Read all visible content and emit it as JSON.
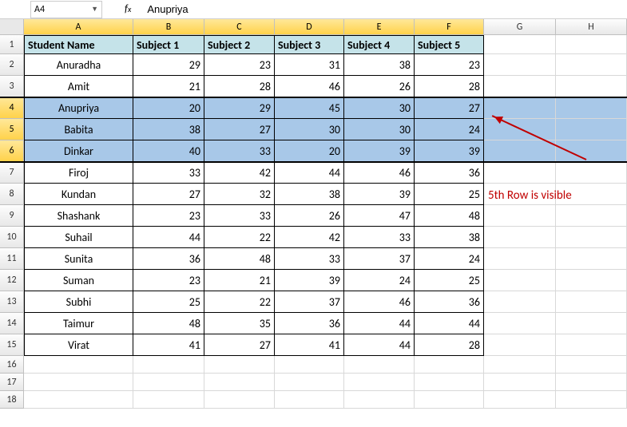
{
  "name_box": "A4",
  "formula_value": "Anupriya",
  "fx": "f",
  "fx_sub": "x",
  "col_labels": [
    "A",
    "B",
    "C",
    "D",
    "E",
    "F",
    "G",
    "H"
  ],
  "row_labels": [
    "1",
    "2",
    "3",
    "4",
    "5",
    "6",
    "7",
    "8",
    "9",
    "10",
    "11",
    "12",
    "13",
    "14",
    "15",
    "16",
    "17",
    "18"
  ],
  "table": {
    "headers": [
      "Student Name",
      "Subject 1",
      "Subject 2",
      "Subject 3",
      "Subject 4",
      "Subject 5"
    ],
    "rows": [
      {
        "name": "Anuradha",
        "s": [
          29,
          23,
          31,
          38,
          23
        ]
      },
      {
        "name": "Amit",
        "s": [
          21,
          28,
          46,
          26,
          28
        ]
      },
      {
        "name": "Anupriya",
        "s": [
          20,
          29,
          45,
          30,
          27
        ]
      },
      {
        "name": "Babita",
        "s": [
          38,
          27,
          30,
          30,
          24
        ]
      },
      {
        "name": "Dinkar",
        "s": [
          40,
          33,
          20,
          39,
          39
        ]
      },
      {
        "name": "Firoj",
        "s": [
          33,
          42,
          44,
          46,
          36
        ]
      },
      {
        "name": "Kundan",
        "s": [
          27,
          32,
          38,
          39,
          25
        ]
      },
      {
        "name": "Shashank",
        "s": [
          23,
          33,
          26,
          47,
          48
        ]
      },
      {
        "name": "Suhail",
        "s": [
          44,
          22,
          42,
          33,
          38
        ]
      },
      {
        "name": "Sunita",
        "s": [
          36,
          48,
          33,
          37,
          24
        ]
      },
      {
        "name": "Suman",
        "s": [
          23,
          21,
          39,
          24,
          25
        ]
      },
      {
        "name": "Subhi",
        "s": [
          25,
          22,
          37,
          46,
          36
        ]
      },
      {
        "name": "Taimur",
        "s": [
          48,
          35,
          36,
          44,
          44
        ]
      },
      {
        "name": "Virat",
        "s": [
          41,
          27,
          41,
          44,
          28
        ]
      }
    ]
  },
  "selected_rows": [
    4,
    5,
    6
  ],
  "annotation_text": "5th Row is visible",
  "row_heights": {
    "1": 24,
    "default": 27,
    "empty": 22
  }
}
